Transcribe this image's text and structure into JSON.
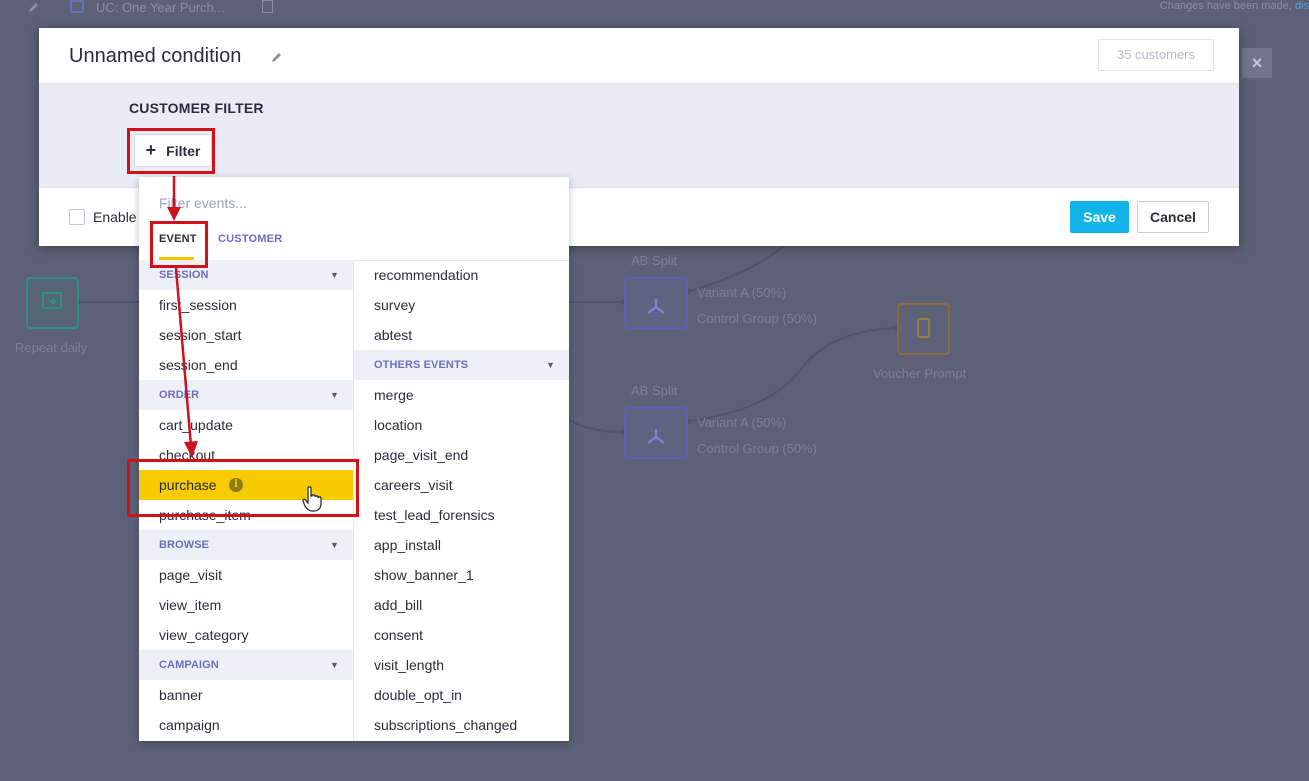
{
  "topbar": {
    "campaign_title": "UC: One Year Purch...",
    "changes_text": "Changes have been made,",
    "changes_link": "dis"
  },
  "canvas": {
    "nodes": [
      {
        "label": "Repeat daily"
      },
      {
        "label": "AB Split"
      },
      {
        "label": "AB Split"
      },
      {
        "label": "Voucher Prompt"
      }
    ],
    "branches": {
      "top_a": "Variant A (50%)",
      "top_b": "Control Group (50%)",
      "bottom_a": "Variant A (50%)",
      "bottom_b": "Control Group (50%)"
    },
    "close_symbol": "×"
  },
  "modal": {
    "title": "Unnamed condition",
    "customer_count": "35 customers",
    "filter_section_title": "CUSTOMER FILTER",
    "filter_button_label": "Filter",
    "filter_button_plus": "+",
    "enable_label": "Enable",
    "save_label": "Save",
    "cancel_label": "Cancel"
  },
  "dropdown": {
    "search_placeholder": "Filter events...",
    "tabs": [
      {
        "label": "EVENT",
        "active": true
      },
      {
        "label": "CUSTOMER",
        "active": false
      }
    ],
    "left_column": [
      {
        "type": "group",
        "label": "SESSION"
      },
      {
        "type": "item",
        "label": "first_session"
      },
      {
        "type": "item",
        "label": "session_start"
      },
      {
        "type": "item",
        "label": "session_end"
      },
      {
        "type": "group",
        "label": "ORDER"
      },
      {
        "type": "item",
        "label": "cart_update"
      },
      {
        "type": "item",
        "label": "checkout"
      },
      {
        "type": "item",
        "label": "purchase",
        "highlighted": true
      },
      {
        "type": "item",
        "label": "purchase_item"
      },
      {
        "type": "group",
        "label": "BROWSE"
      },
      {
        "type": "item",
        "label": "page_visit"
      },
      {
        "type": "item",
        "label": "view_item"
      },
      {
        "type": "item",
        "label": "view_category"
      },
      {
        "type": "group",
        "label": "CAMPAIGN"
      },
      {
        "type": "item",
        "label": "banner"
      },
      {
        "type": "item",
        "label": "campaign"
      }
    ],
    "right_column": [
      {
        "type": "item",
        "label": "recommendation"
      },
      {
        "type": "item",
        "label": "survey"
      },
      {
        "type": "item",
        "label": "abtest"
      },
      {
        "type": "group",
        "label": "OTHERS EVENTS"
      },
      {
        "type": "item",
        "label": "merge"
      },
      {
        "type": "item",
        "label": "location"
      },
      {
        "type": "item",
        "label": "page_visit_end"
      },
      {
        "type": "item",
        "label": "careers_visit"
      },
      {
        "type": "item",
        "label": "test_lead_forensics"
      },
      {
        "type": "item",
        "label": "app_install"
      },
      {
        "type": "item",
        "label": "show_banner_1"
      },
      {
        "type": "item",
        "label": "add_bill"
      },
      {
        "type": "item",
        "label": "consent"
      },
      {
        "type": "item",
        "label": "visit_length"
      },
      {
        "type": "item",
        "label": "double_opt_in"
      },
      {
        "type": "item",
        "label": "subscriptions_changed"
      }
    ],
    "info_symbol": "i"
  },
  "colors": {
    "accent_blue": "#12b4e8",
    "highlight_yellow": "#f6cb00",
    "annotation_red": "#d0101a",
    "group_text": "#6c6fbd"
  }
}
